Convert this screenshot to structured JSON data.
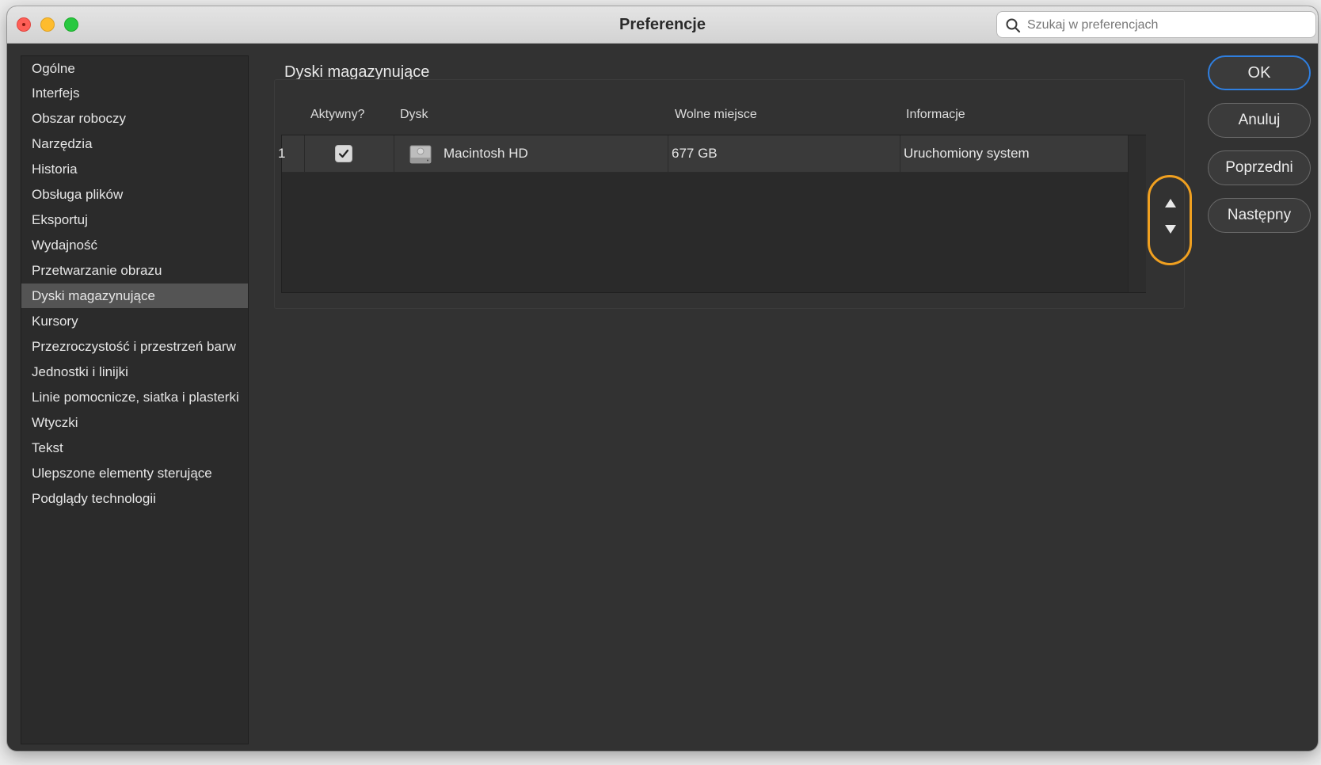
{
  "window": {
    "title": "Preferencje"
  },
  "search": {
    "placeholder": "Szukaj w preferencjach",
    "value": ""
  },
  "sidebar": {
    "items": [
      {
        "label": "Ogólne"
      },
      {
        "label": "Interfejs"
      },
      {
        "label": "Obszar roboczy"
      },
      {
        "label": "Narzędzia"
      },
      {
        "label": "Historia"
      },
      {
        "label": "Obsługa plików"
      },
      {
        "label": "Eksportuj"
      },
      {
        "label": "Wydajność"
      },
      {
        "label": "Przetwarzanie obrazu"
      },
      {
        "label": "Dyski magazynujące",
        "selected": true
      },
      {
        "label": "Kursory"
      },
      {
        "label": "Przezroczystość i przestrzeń barw"
      },
      {
        "label": "Jednostki i linijki"
      },
      {
        "label": "Linie pomocnicze, siatka i plasterki"
      },
      {
        "label": "Wtyczki"
      },
      {
        "label": "Tekst"
      },
      {
        "label": "Ulepszone elementy sterujące"
      },
      {
        "label": "Podglądy technologii"
      }
    ]
  },
  "main": {
    "section_title": "Dyski magazynujące",
    "table": {
      "columns": [
        "Aktywny?",
        "Dysk",
        "Wolne miejsce",
        "Informacje"
      ],
      "rows": [
        {
          "index": "1",
          "active": true,
          "disk": "Macintosh HD",
          "free_space": "677 GB",
          "info": "Uruchomiony system",
          "icon": "hard-drive-icon"
        }
      ]
    },
    "order_controls": {
      "up_icon": "triangle-up-icon",
      "down_icon": "triangle-down-icon",
      "highlight_color": "#f0a020"
    }
  },
  "buttons": {
    "ok": "OK",
    "cancel": "Anuluj",
    "prev": "Poprzedni",
    "next": "Następny",
    "primary_color": "#2f7fe0"
  }
}
